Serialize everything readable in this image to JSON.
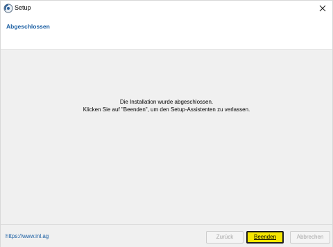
{
  "window": {
    "title": "Setup"
  },
  "header": {
    "title": "Abgeschlossen"
  },
  "main": {
    "message_line1": "Die Installation wurde abgeschlossen.",
    "message_line2": "Klicken Sie auf \"Beenden\", um den Setup-Assistenten zu verlassen."
  },
  "footer": {
    "link": "https://www.inl.ag",
    "back_label": "Zurück",
    "finish_label": "Beenden",
    "cancel_label": "Abbrechen"
  },
  "icons": {
    "app": "setup-app-icon",
    "close": "close-icon"
  },
  "colors": {
    "accent": "#1b5fa3",
    "finish_button": "#f5e600"
  }
}
